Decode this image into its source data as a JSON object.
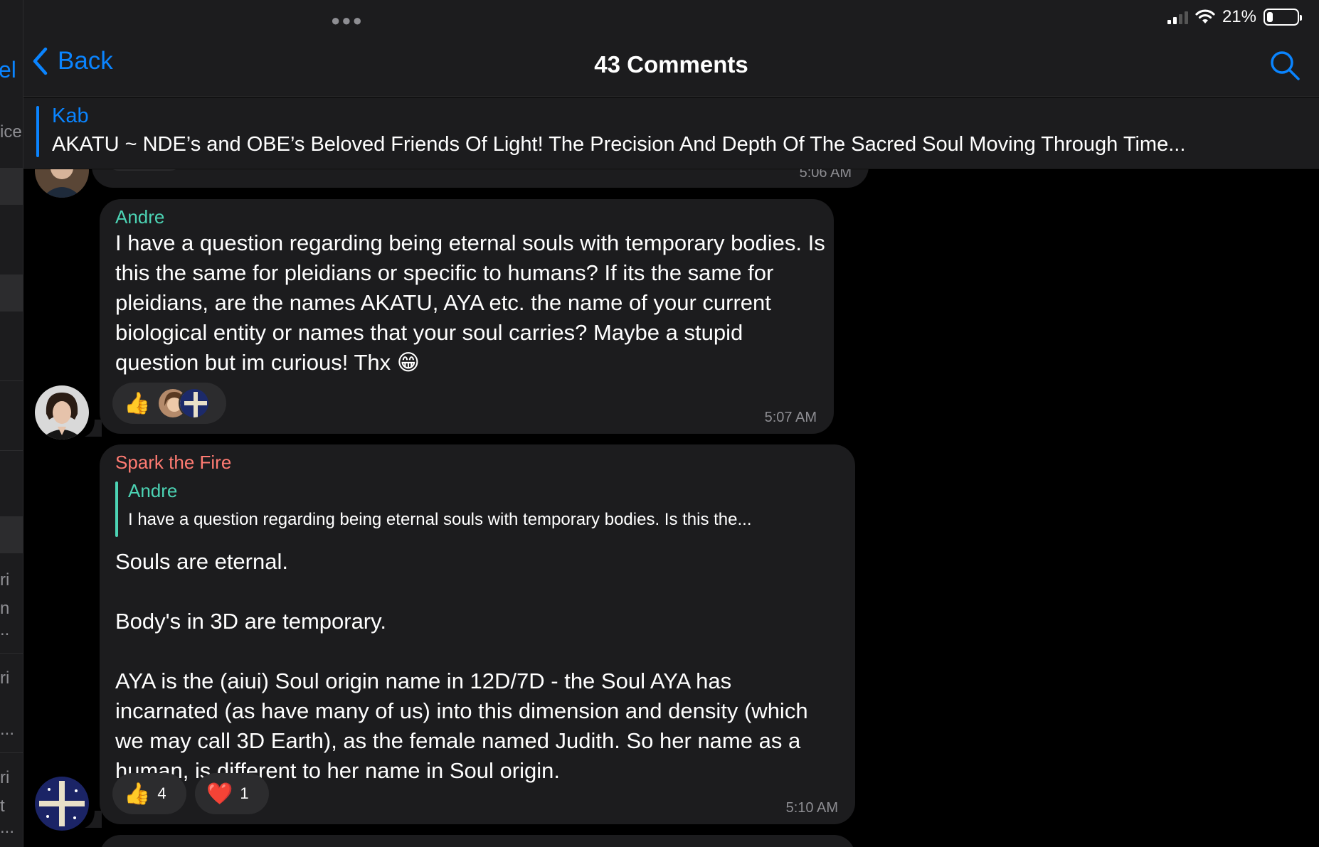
{
  "background_app": {
    "fragments": [
      "el",
      "ice",
      "ri",
      "n",
      "..",
      "ri",
      "...",
      "ri",
      "t",
      "..."
    ]
  },
  "status_bar": {
    "battery": "21%",
    "battery_level": 0.21
  },
  "nav": {
    "back_label": "Back",
    "title": "43 Comments"
  },
  "pinned": {
    "author": "Kab",
    "text": "AKATU ~ NDE’s and OBE’s    Beloved Friends Of Light!    The Precision And Depth Of The Sacred Soul Moving Through Time..."
  },
  "messages": [
    {
      "time": "5:06 AM"
    },
    {
      "author": "Andre",
      "author_color": "#4cd3b4",
      "text": "I have a question regarding being eternal souls with temporary bodies. Is this the same for pleidians or specific to humans? If its the same for pleidians, are the names AKATU, AYA etc. the name of your current biological entity or names that your soul carries? Maybe a stupid question but im curious! Thx 😁",
      "reaction_emoji": "👍",
      "time": "5:07 AM"
    },
    {
      "author": "Spark the Fire",
      "author_color": "#ff7b72",
      "reply_author": "Andre",
      "reply_text": "I have a question regarding being eternal souls with temporary bodies. Is this the...",
      "text": "Souls are eternal.\n\nBody's in 3D are temporary.\n\nAYA is the (aiui) Soul origin name in 12D/7D - the Soul AYA has incarnated (as have many of us) into this dimension and density (which we may call 3D Earth), as the female named Judith.  So her name as a human, is different to her name in Soul origin.",
      "reactions": [
        {
          "emoji": "👍",
          "count": "4"
        },
        {
          "emoji": "❤️",
          "count": "1"
        }
      ],
      "time": "5:10 AM"
    }
  ]
}
